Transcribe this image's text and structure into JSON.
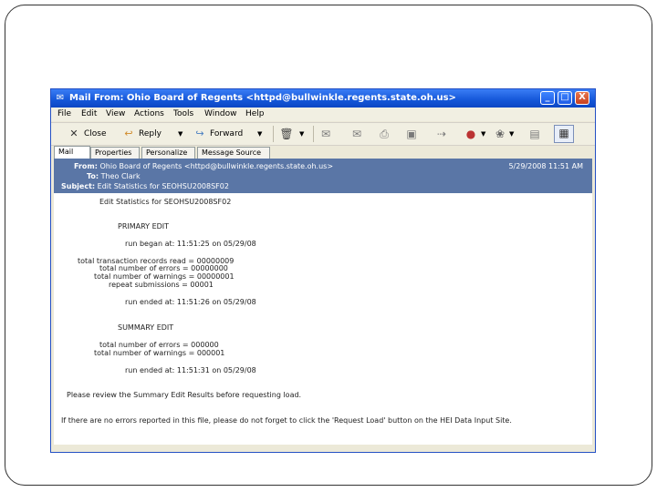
{
  "window": {
    "title": "Mail From: Ohio Board of Regents <httpd@bullwinkle.regents.state.oh.us>",
    "minimize_glyph": "_",
    "maximize_glyph": "□",
    "close_glyph": "X"
  },
  "menu": [
    "File",
    "Edit",
    "View",
    "Actions",
    "Tools",
    "Window",
    "Help"
  ],
  "toolbar": {
    "close_label": "Close",
    "reply_label": "Reply",
    "forward_label": "Forward"
  },
  "tabs": [
    "Mail",
    "Properties",
    "Personalize",
    "Message Source"
  ],
  "message": {
    "from_label": "From:",
    "from_value": "Ohio Board of Regents <httpd@bullwinkle.regents.state.oh.us>",
    "date": "5/29/2008 11:51 AM",
    "to_label": "To:",
    "to_value": "Theo Clark",
    "subject_label": "Subject:",
    "subject_value": "Edit Statistics for SEOHSU2008SF02"
  },
  "body_lines": [
    "Edit Statistics for SEOHSU2008SF02",
    "PRIMARY EDIT",
    "run began at:  11:51:25 on 05/29/08",
    "total transaction records read = 00000009",
    "total number of errors = 00000000",
    "total number of warnings = 00000001",
    "repeat submissions = 00001",
    "run ended at:  11:51:26 on 05/29/08",
    "SUMMARY EDIT",
    "total number of errors = 000000",
    "total number of warnings = 000001",
    "run ended at:  11:51:31 on 05/29/08",
    "Please review the Summary Edit Results before requesting load.",
    "If there are no errors reported in this file, please do not forget to click the 'Request Load' button on the HEI Data Input Site."
  ]
}
